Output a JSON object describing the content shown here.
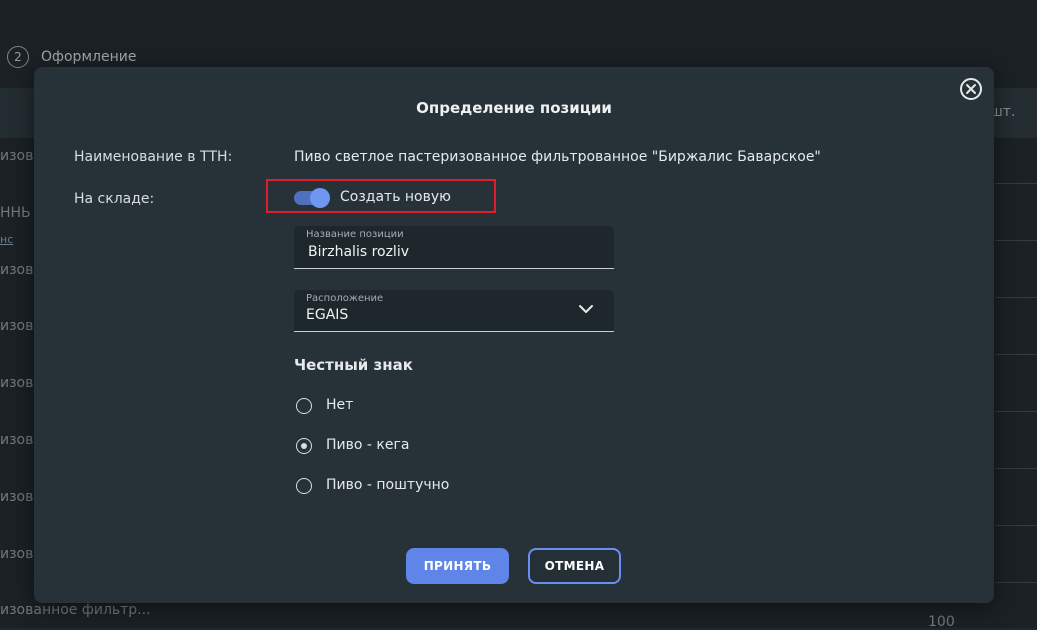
{
  "background": {
    "step_number": "2",
    "step_label": "Оформление",
    "column_unit": "шт.",
    "left_fragments": [
      "изова",
      "ННЬ",
      "изова",
      "изова",
      "изова",
      "изова",
      "изова",
      "изова"
    ],
    "left_link": "нс",
    "bottom_text": "изованное фильтр...",
    "bottom_number": "100"
  },
  "modal": {
    "title": "Определение позиции",
    "ttn_label": "Наименование в ТТН:",
    "ttn_value": "Пиво светлое пастеризованное фильтрованное \"Биржалис Баварское\"",
    "stock_label": "На складе:",
    "toggle": {
      "label": "Создать новую",
      "on": true
    },
    "position_name": {
      "label": "Название позиции",
      "value": "Birzhalis rozliv"
    },
    "location": {
      "label": "Расположение",
      "value": "EGAIS"
    },
    "honest_sign": {
      "title": "Честный знак",
      "options": [
        {
          "label": "Нет",
          "selected": false
        },
        {
          "label": "Пиво - кега",
          "selected": true
        },
        {
          "label": "Пиво - поштучно",
          "selected": false
        }
      ]
    },
    "buttons": {
      "accept": "ПРИНЯТЬ",
      "cancel": "ОТМЕНА"
    }
  },
  "colors": {
    "accent": "#5f85e8",
    "highlight": "#e01e2a",
    "modal_bg": "#273238"
  }
}
